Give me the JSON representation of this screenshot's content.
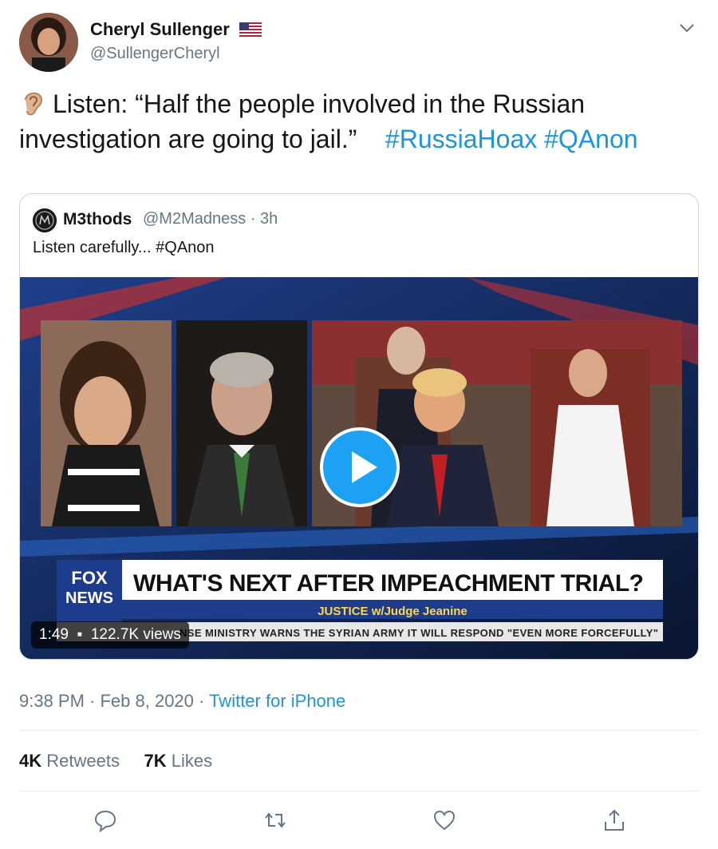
{
  "author": {
    "name": "Cheryl Sullenger",
    "handle": "@SullengerCheryl",
    "flag_icon": "us-flag-icon"
  },
  "tweet": {
    "prefix_icon": "ear-icon",
    "text": "Listen: “Half the people involved in the Russian investigation are going to jail.”",
    "hashtags": [
      "#RussiaHoax",
      "#QAnon"
    ]
  },
  "quoted_tweet": {
    "name": "M3thods",
    "handle": "@M2Madness",
    "time": "· 3h",
    "text": "Listen carefully... #QAnon",
    "video": {
      "duration": "1:49",
      "views": "122.7K views",
      "chyron_logo_top": "FOX",
      "chyron_logo_bottom": "NEWS",
      "chyron_headline": "WHAT'S NEXT AFTER IMPEACHMENT TRIAL?",
      "chyron_show": "JUSTICE w/Judge Jeanine",
      "chyron_ticker": "NSE MINISTRY WARNS THE SYRIAN ARMY IT WILL RESPOND \"EVEN MORE FORCEFULLY\""
    }
  },
  "meta": {
    "timestamp": "9:38 PM · Feb 8, 2020",
    "separator": "·",
    "source": "Twitter for iPhone"
  },
  "stats": {
    "retweets_count": "4K",
    "retweets_label": "Retweets",
    "likes_count": "7K",
    "likes_label": "Likes"
  },
  "colors": {
    "accent": "#1b95e0",
    "play_button": "#1da1f2",
    "secondary_text": "#657786"
  }
}
